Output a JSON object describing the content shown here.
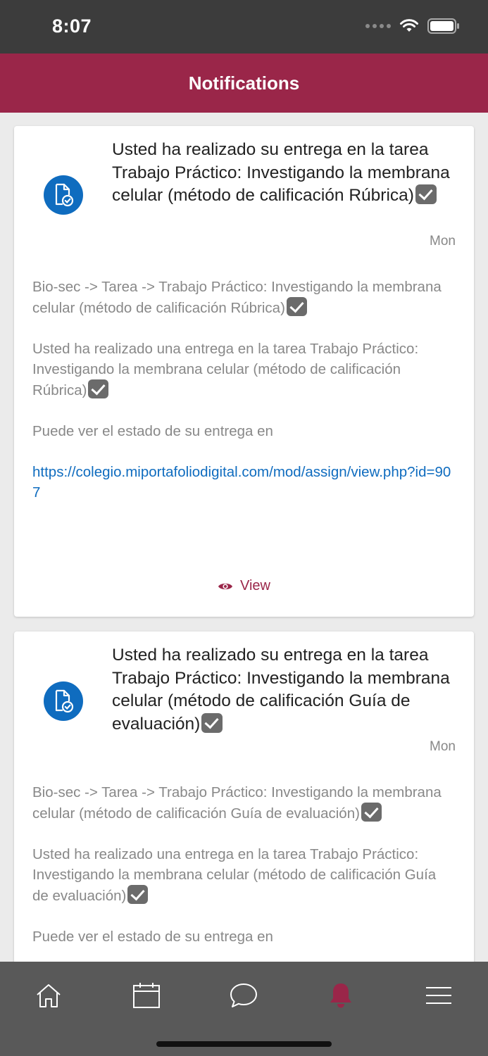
{
  "status_bar": {
    "time": "8:07"
  },
  "header": {
    "title": "Notifications"
  },
  "notifications": [
    {
      "title": "Usted ha realizado su entrega en la tarea Trabajo Práctico: Investigando la membrana celular (método de calificación Rúbrica)",
      "time": "Mon",
      "context": "Bio-sec -> Tarea -> Trabajo Práctico: Investigando la membrana celular (método de calificación Rúbrica)",
      "message": "Usted ha realizado una entrega en la tarea Trabajo Práctico: Investigando la membrana celular (método de calificación Rúbrica)",
      "status_text": "Puede ver el estado de su entrega en",
      "link": "https://colegio.miportafoliodigital.com/mod/assign/view.php?id=907",
      "view_label": "View"
    },
    {
      "title": "Usted ha realizado su entrega en la tarea Trabajo Práctico: Investigando la membrana celular (método de calificación Guía de evaluación)",
      "time": "Mon",
      "context": "Bio-sec -> Tarea -> Trabajo Práctico: Investigando la membrana celular (método de calificación Guía de evaluación)",
      "message": "Usted ha realizado una entrega en la tarea Trabajo Práctico: Investigando la membrana celular (método de calificación Guía de evaluación)",
      "status_text": "Puede ver el estado de su entrega en"
    }
  ],
  "tab_bar": {
    "tabs": [
      {
        "icon": "home-icon",
        "active": false
      },
      {
        "icon": "calendar-icon",
        "active": false
      },
      {
        "icon": "chat-icon",
        "active": false
      },
      {
        "icon": "bell-icon",
        "active": true
      },
      {
        "icon": "menu-icon",
        "active": false
      }
    ]
  },
  "colors": {
    "brand": "#9a2649",
    "icon_blue": "#0f6cbf",
    "tab_bar": "#595959"
  }
}
